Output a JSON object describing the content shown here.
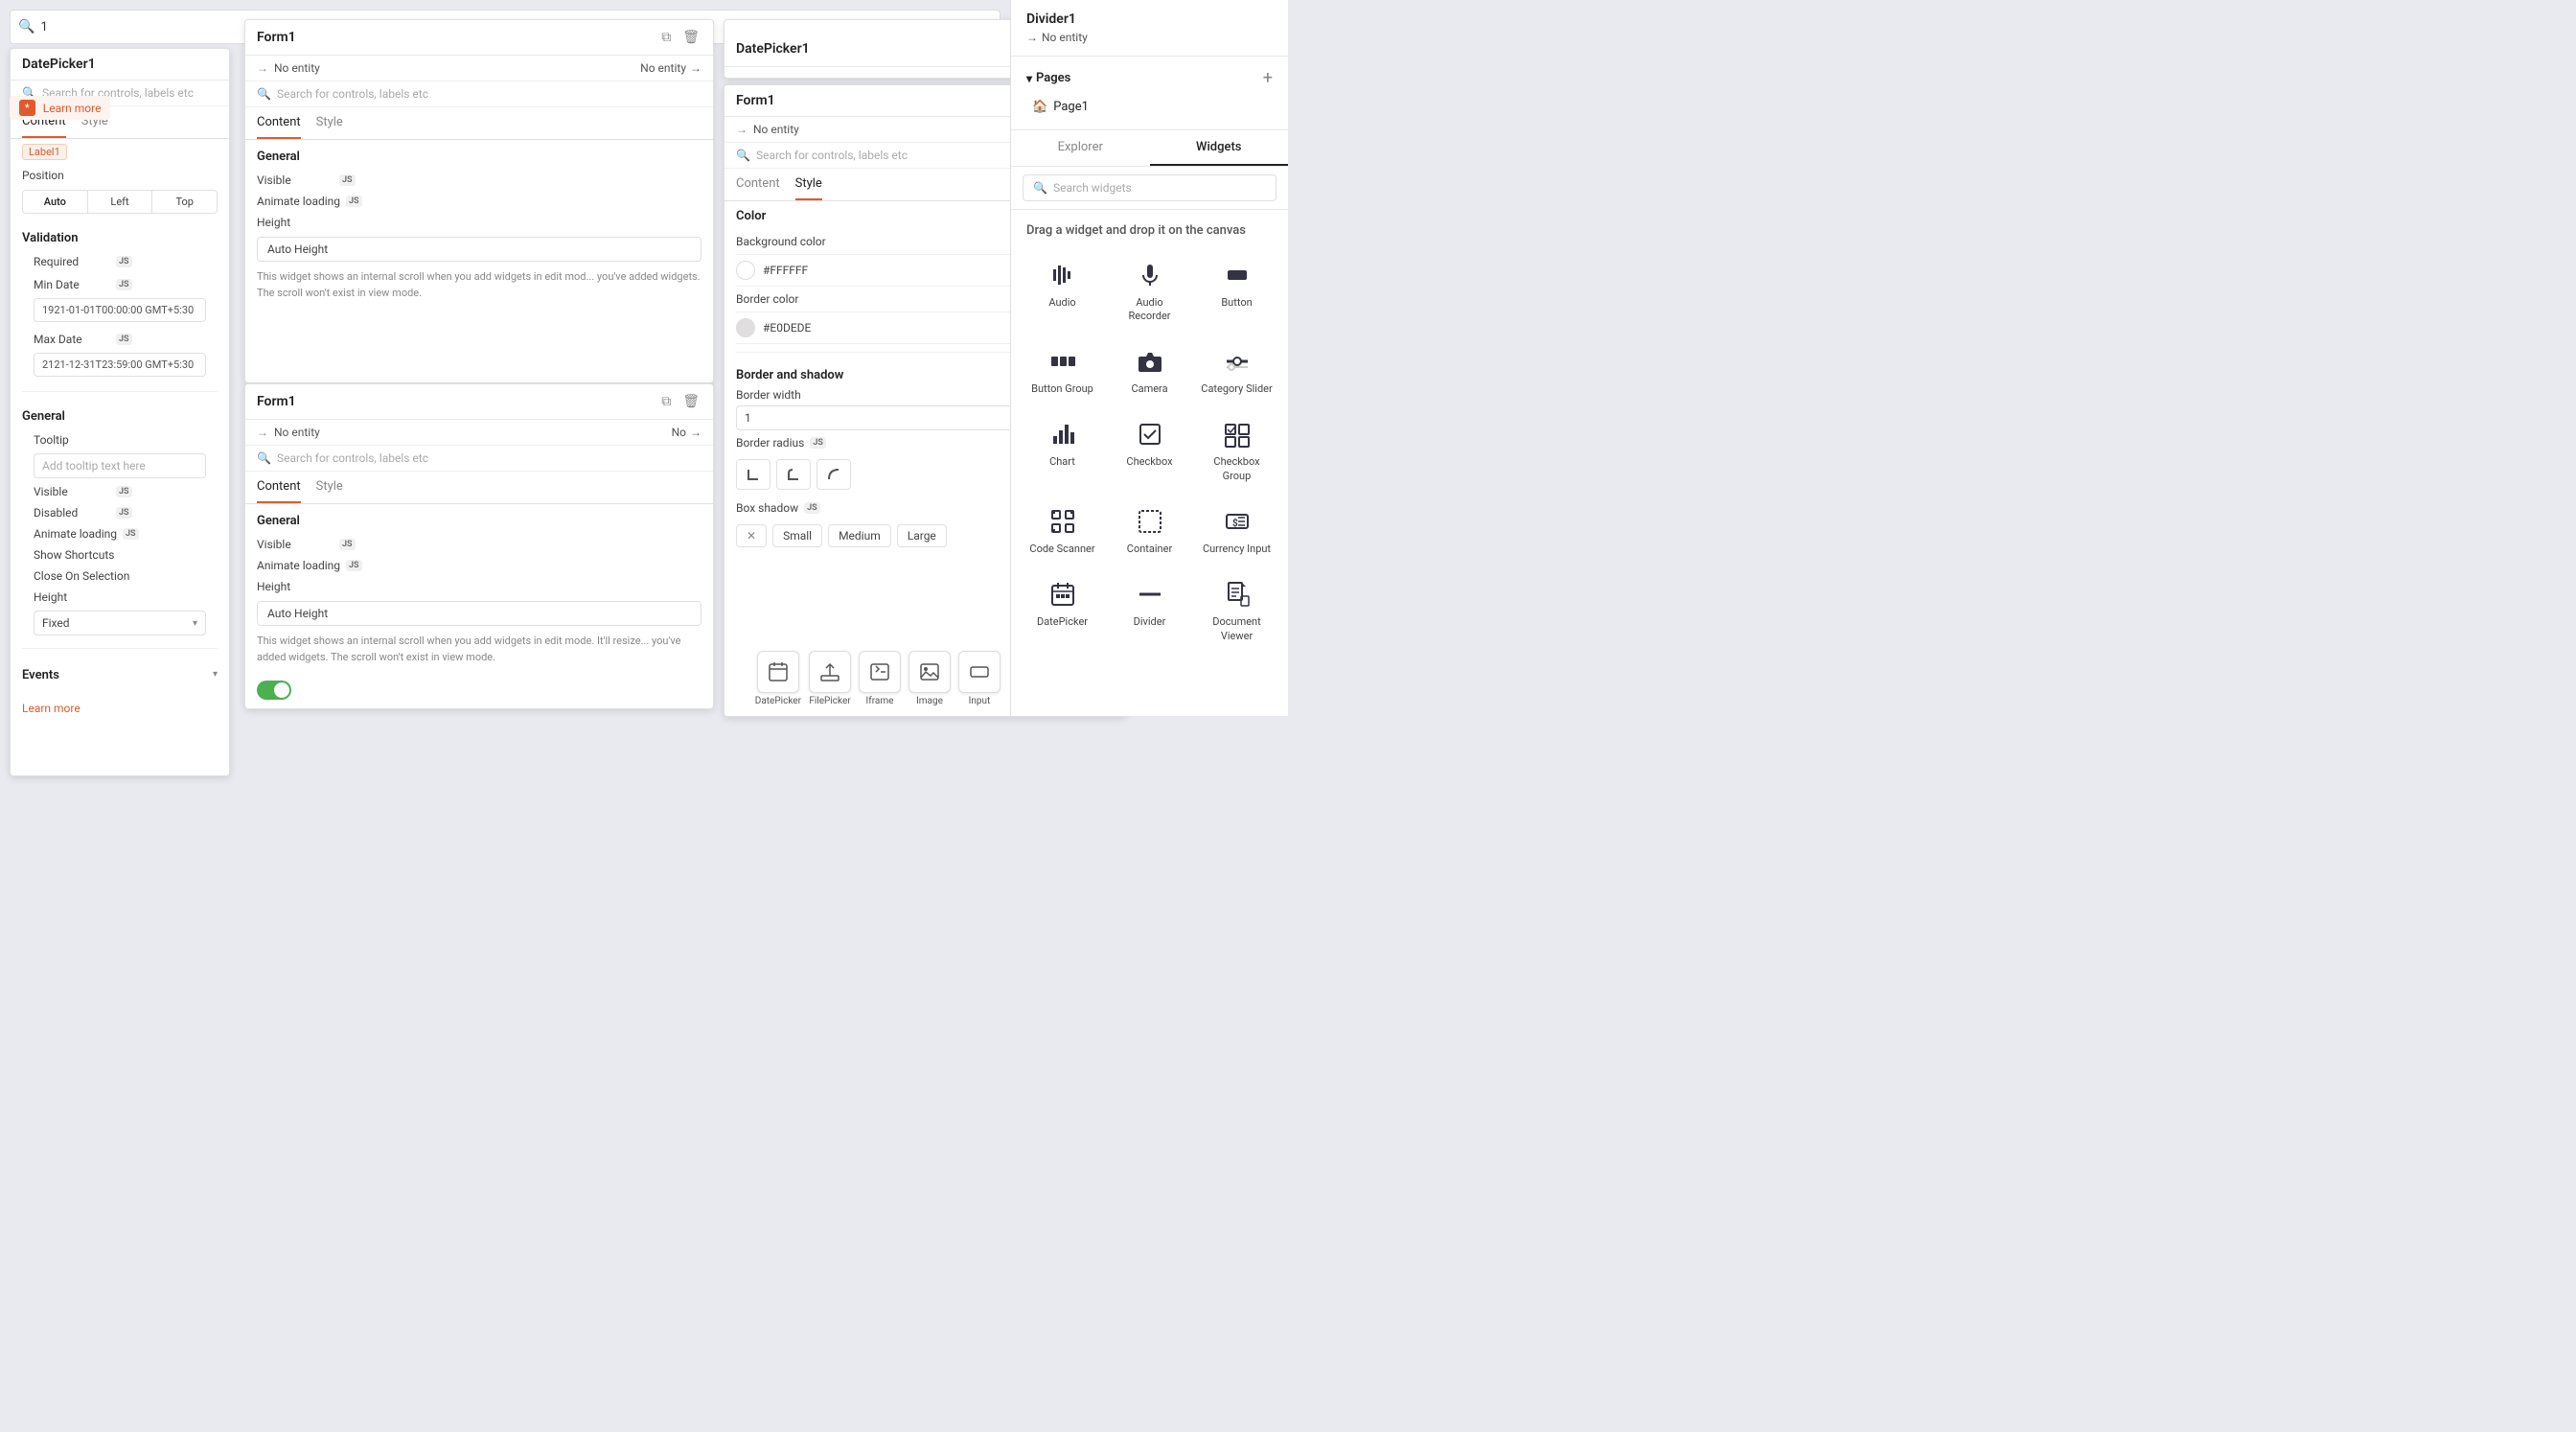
{
  "leftPanel": {
    "title": "DatePicker1",
    "searchPlaceholder": "Search for controls, labels etc",
    "tabs": [
      "Content",
      "Style"
    ],
    "activeTab": "Content",
    "labelTag": "Label1",
    "position": {
      "label": "Position",
      "options": [
        "Auto",
        "Left",
        "Top"
      ]
    },
    "validation": {
      "title": "Validation",
      "required": {
        "label": "Required",
        "hasJs": true
      },
      "minDate": {
        "label": "Min Date",
        "hasJs": true,
        "value": "1921-01-01T00:00:00 GMT+5:30"
      },
      "maxDate": {
        "label": "Max Date",
        "hasJs": true,
        "value": "2121-12-31T23:59:00 GMT+5:30"
      }
    },
    "general": {
      "title": "General",
      "tooltip": {
        "label": "Tooltip",
        "placeholder": "Add tooltip text here"
      },
      "visible": {
        "label": "Visible",
        "hasJs": true
      },
      "disabled": {
        "label": "Disabled",
        "hasJs": true
      },
      "animateLoading": {
        "label": "Animate loading",
        "hasJs": true
      },
      "showShortcuts": {
        "label": "Show Shortcuts"
      },
      "closeOnSelection": {
        "label": "Close On Selection"
      },
      "height": {
        "label": "Height"
      },
      "heightValue": "Fixed"
    },
    "events": {
      "title": "Events"
    },
    "learnMore": "Learn more"
  },
  "formPanel1": {
    "title": "Form1",
    "entityLabel": "No entity",
    "entityRight": "No entity",
    "searchPlaceholder": "Search for controls, labels etc",
    "tabs": [
      "Content",
      "Style"
    ],
    "activeTab": "Content",
    "general": {
      "title": "General",
      "visible": {
        "label": "Visible",
        "hasJs": true
      },
      "animateLoading": {
        "label": "Animate loading",
        "hasJs": true
      },
      "height": {
        "label": "Height"
      }
    },
    "autoHeight": "Auto Height",
    "infoText": "This widget shows an internal scroll when you add widgets in edit mod... you've added widgets. The scroll won't exist in view mode."
  },
  "formPanel2": {
    "title": "Form1",
    "entityLabel": "No entity",
    "entityRight": "No",
    "searchPlaceholder": "Search for controls, labels etc",
    "tabs": [
      "Content",
      "Style"
    ],
    "activeTab": "Content",
    "general": {
      "title": "General",
      "visible": {
        "label": "Visible",
        "hasJs": true
      },
      "animateLoading": {
        "label": "Animate loading",
        "hasJs": true
      },
      "height": {
        "label": "Height"
      }
    },
    "autoHeight": "Auto Height",
    "infoText": "This widget shows an internal scroll when you add widgets in edit mode. It'll resize... you've added widgets. The scroll won't exist in view mode.",
    "toggleOn": true
  },
  "stylePanel": {
    "title": "Form1",
    "entityLabel": "No entity",
    "searchPlaceholder": "Search for controls, labels etc",
    "tabs": [
      "Content",
      "Style"
    ],
    "activeTab": "Style",
    "color": {
      "title": "Color",
      "backgroundColor": {
        "label": "Background color",
        "hasJs": true,
        "value": "#FFFFFF",
        "swatch": "#FFFFFF"
      },
      "borderColor": {
        "label": "Border color",
        "value": "#E0DEDE",
        "swatch": "#E0DEDE"
      }
    },
    "borderAndShadow": {
      "title": "Border and shadow",
      "borderWidth": {
        "label": "Border width",
        "value": "1"
      },
      "borderRadius": {
        "label": "Border radius",
        "hasJs": true
      },
      "boxShadow": {
        "label": "Box shadow",
        "hasJs": true,
        "options": [
          "None",
          "Small",
          "Medium",
          "Large"
        ]
      }
    }
  },
  "rightSidebar": {
    "title": "Divider1",
    "entityLabel": "No entity",
    "pagesTitle": "Pages",
    "addPageLabel": "+",
    "pages": [
      {
        "label": "Page1",
        "icon": "🏠"
      }
    ],
    "tabs": [
      "Explorer",
      "Widgets"
    ],
    "activeTab": "Widgets",
    "searchPlaceholder": "Search widgets",
    "dragHint": "Drag a widget and drop it on the canvas",
    "widgets": [
      {
        "name": "audio-widget",
        "label": "Audio",
        "icon": "audio"
      },
      {
        "name": "audio-recorder-widget",
        "label": "Audio Recorder",
        "icon": "mic"
      },
      {
        "name": "button-widget",
        "label": "Button",
        "icon": "button"
      },
      {
        "name": "button-group-widget",
        "label": "Button Group",
        "icon": "buttongroup"
      },
      {
        "name": "camera-widget",
        "label": "Camera",
        "icon": "camera"
      },
      {
        "name": "category-slider-widget",
        "label": "Category Slider",
        "icon": "catslider"
      },
      {
        "name": "chart-widget",
        "label": "Chart",
        "icon": "chart"
      },
      {
        "name": "checkbox-widget",
        "label": "Checkbox",
        "icon": "checkbox"
      },
      {
        "name": "checkbox-group-widget",
        "label": "Checkbox Group",
        "icon": "checkboxgroup"
      },
      {
        "name": "code-scanner-widget",
        "label": "Code Scanner",
        "icon": "codescanner"
      },
      {
        "name": "container-widget",
        "label": "Container",
        "icon": "container"
      },
      {
        "name": "currency-input-widget",
        "label": "Currency Input",
        "icon": "currencyinput"
      },
      {
        "name": "datepicker-widget",
        "label": "DatePicker",
        "icon": "datepicker"
      },
      {
        "name": "divider-widget",
        "label": "Divider",
        "icon": "divider"
      },
      {
        "name": "document-viewer-widget",
        "label": "Document Viewer",
        "icon": "docviewer"
      }
    ]
  },
  "bottomIcons": [
    {
      "name": "datepicker-bottom",
      "label": "DatePicker"
    },
    {
      "name": "filepicker-bottom",
      "label": "FilePicker"
    },
    {
      "name": "iframe-bottom",
      "label": "Iframe"
    },
    {
      "name": "image-bottom",
      "label": "Image"
    },
    {
      "name": "input-bottom",
      "label": "Input"
    }
  ],
  "topBar": {
    "searchValue": "1"
  }
}
